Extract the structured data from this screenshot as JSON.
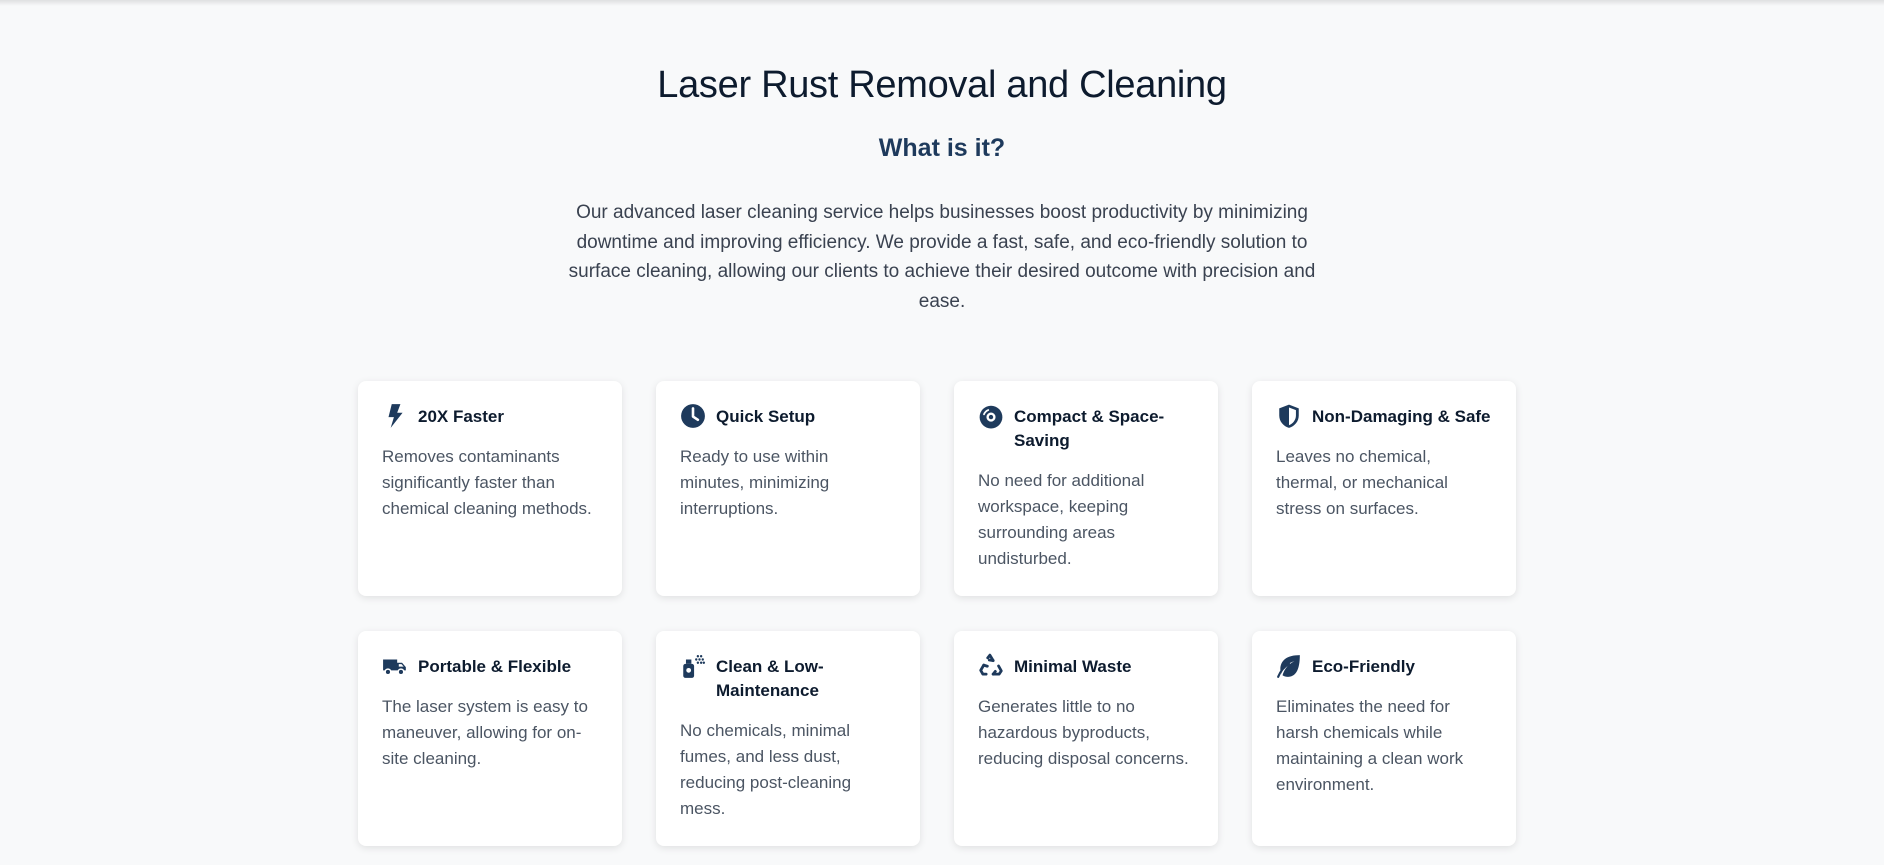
{
  "hero": {
    "title": "Laser Rust Removal and Cleaning",
    "subtitle": "What is it?",
    "intro": "Our advanced laser cleaning service helps businesses boost productivity by minimizing downtime and improving efficiency. We provide a fast, safe, and eco-friendly solution to surface cleaning, allowing our clients to achieve their desired outcome with precision and ease."
  },
  "colors": {
    "background": "#f8f9fa",
    "heading": "#0d1b2e",
    "accent": "#1e3a5c",
    "body_text": "#4b5563",
    "card": "#ffffff"
  },
  "features": [
    {
      "icon": "bolt-icon",
      "title": "20X Faster",
      "text": "Removes contaminants significantly faster than chemical cleaning methods."
    },
    {
      "icon": "clock-icon",
      "title": "Quick Setup",
      "text": "Ready to use within minutes, minimizing interruptions."
    },
    {
      "icon": "compact-disc-icon",
      "title": "Compact & Space-Saving",
      "text": "No need for additional workspace, keeping surrounding areas undisturbed."
    },
    {
      "icon": "shield-icon",
      "title": "Non-Damaging & Safe",
      "text": "Leaves no chemical, thermal, or mechanical stress on surfaces."
    },
    {
      "icon": "truck-icon",
      "title": "Portable & Flexible",
      "text": "The laser system is easy to maneuver, allowing for on-site cleaning."
    },
    {
      "icon": "spray-can-icon",
      "title": "Clean & Low-Maintenance",
      "text": "No chemicals, minimal fumes, and less dust, reducing post-cleaning mess."
    },
    {
      "icon": "recycle-icon",
      "title": "Minimal Waste",
      "text": "Generates little to no hazardous byproducts, reducing disposal concerns."
    },
    {
      "icon": "leaf-icon",
      "title": "Eco-Friendly",
      "text": "Eliminates the need for harsh chemicals while maintaining a clean work environment."
    }
  ]
}
